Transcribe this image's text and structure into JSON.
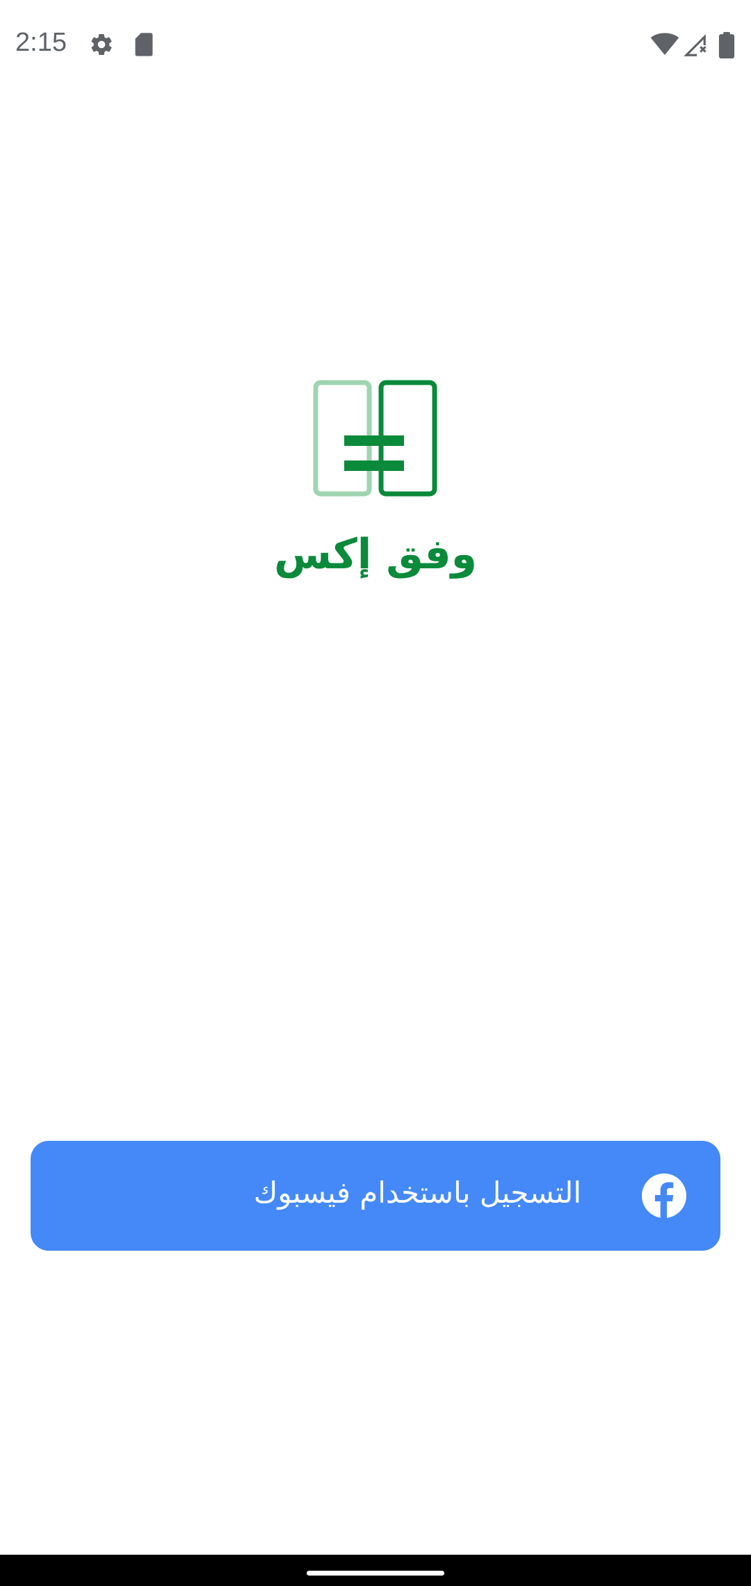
{
  "status_bar": {
    "time": "2:15",
    "icons": [
      "gear-icon",
      "sd-card-icon",
      "wifi-icon",
      "cellular-no-signal-icon",
      "battery-icon"
    ]
  },
  "app": {
    "title": "وفق إكس",
    "logo_icon": "app-logo-icon",
    "colors": {
      "brand_green": "#0a8a3a",
      "brand_green_light": "#9fd4b1"
    }
  },
  "login": {
    "facebook_button_label": "التسجيل باستخدام فيسبوك",
    "facebook_icon": "facebook-icon",
    "button_color": "#4489f7"
  },
  "nav_bar": {
    "handle": "gesture-handle"
  }
}
